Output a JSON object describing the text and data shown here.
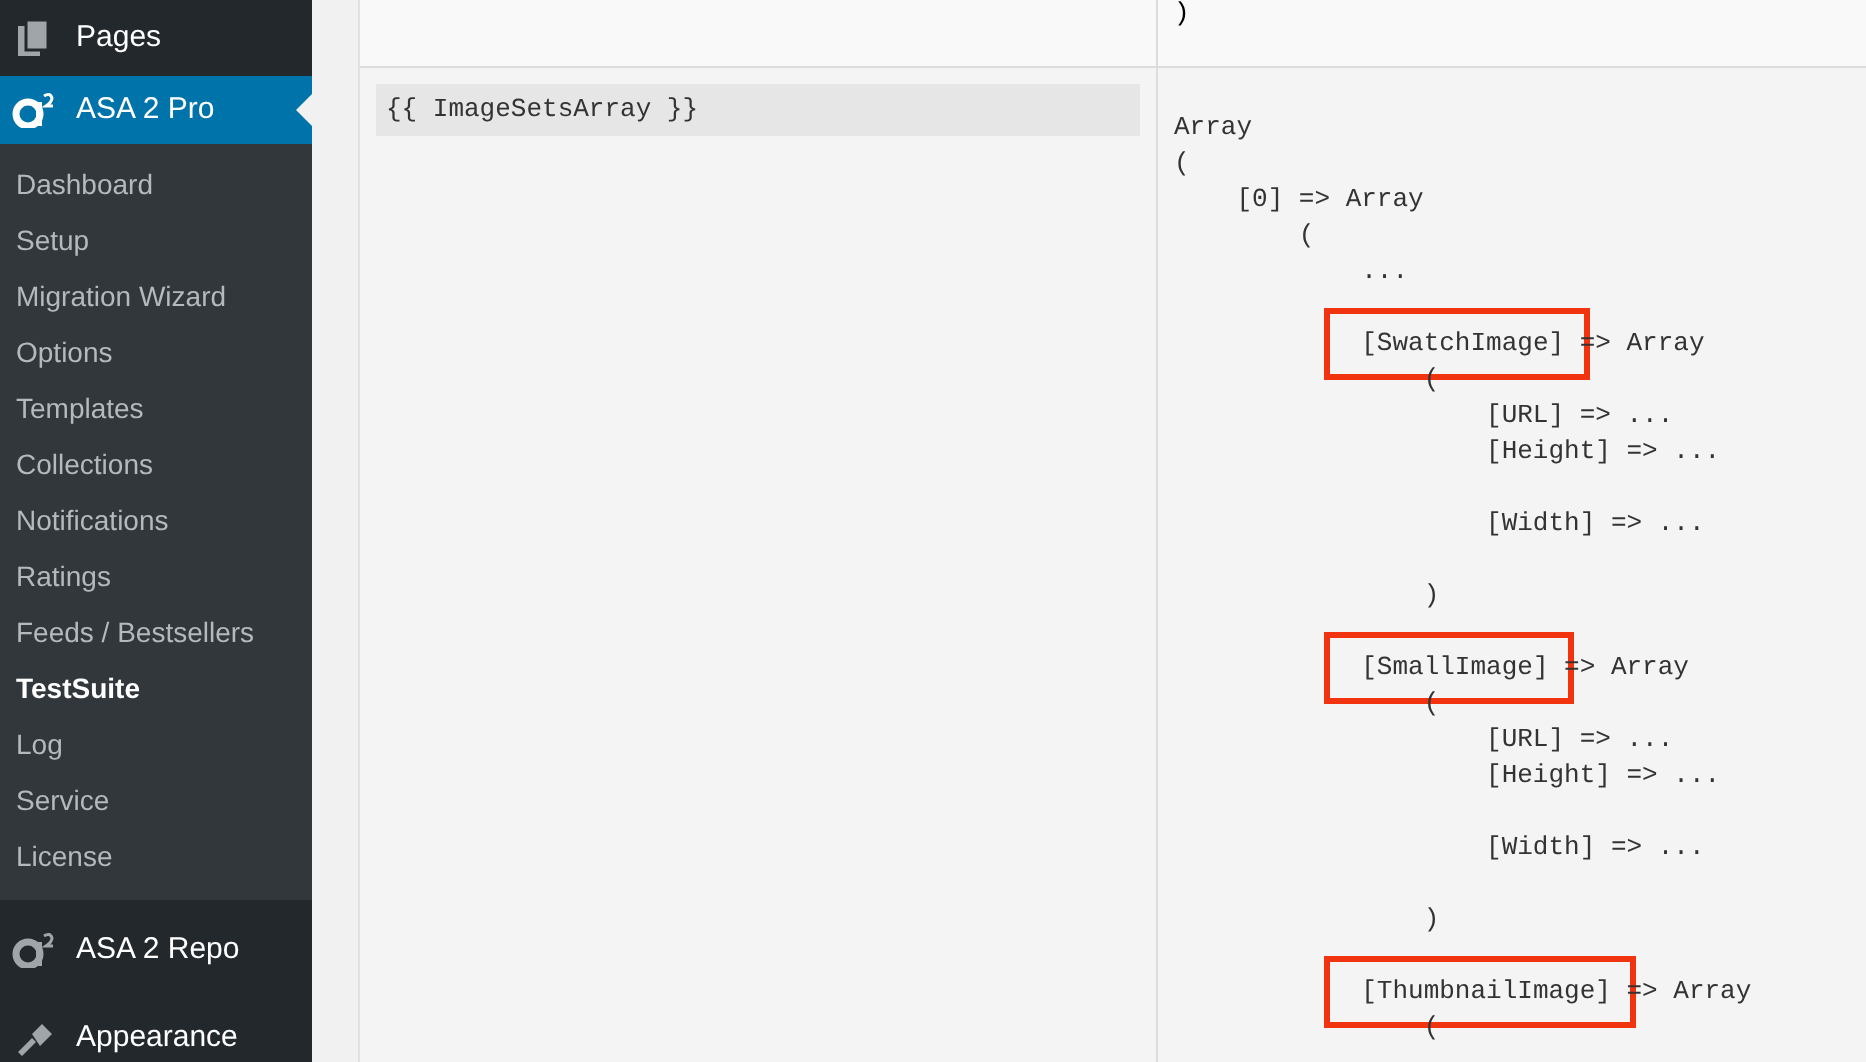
{
  "sidebar": {
    "menu_top": [
      {
        "label": "Pages",
        "kind": "pages",
        "selected": false
      },
      {
        "label": "ASA 2 Pro",
        "kind": "asa",
        "selected": true
      }
    ],
    "submenu": [
      {
        "label": "Dashboard",
        "selected": false
      },
      {
        "label": "Setup",
        "selected": false
      },
      {
        "label": "Migration Wizard",
        "selected": false
      },
      {
        "label": "Options",
        "selected": false
      },
      {
        "label": "Templates",
        "selected": false
      },
      {
        "label": "Collections",
        "selected": false
      },
      {
        "label": "Notifications",
        "selected": false
      },
      {
        "label": "Ratings",
        "selected": false
      },
      {
        "label": "Feeds / Bestsellers",
        "selected": false
      },
      {
        "label": "TestSuite",
        "selected": true
      },
      {
        "label": "Log",
        "selected": false
      },
      {
        "label": "Service",
        "selected": false
      },
      {
        "label": "License",
        "selected": false
      }
    ],
    "menu_bottom": [
      {
        "label": "ASA 2 Repo",
        "kind": "asa",
        "selected": false
      },
      {
        "label": "Appearance",
        "kind": "brush",
        "selected": false
      }
    ]
  },
  "table": {
    "top_row": {
      "output_tail": ")"
    },
    "row": {
      "placeholder_code": "{{ ImageSetsArray }}",
      "output": [
        {
          "text": "Array"
        },
        {
          "text": "("
        },
        {
          "text": "    [0] => Array"
        },
        {
          "text": "        ("
        },
        {
          "text": "            ..."
        },
        {
          "text": "            [SwatchImage]",
          "after": " => Array",
          "highlighted": true,
          "space_before": true
        },
        {
          "text": "                ("
        },
        {
          "text": "                    [URL] => ..."
        },
        {
          "text": "                    [Height] => ..."
        },
        {
          "text": "                    [Width] => ...",
          "space_before": true
        },
        {
          "text": "                )",
          "space_before": true
        },
        {
          "text": "            [SmallImage]",
          "after": " => Array",
          "highlighted": true,
          "space_before": true
        },
        {
          "text": "                ("
        },
        {
          "text": "                    [URL] => ..."
        },
        {
          "text": "                    [Height] => ..."
        },
        {
          "text": "                    [Width] => ...",
          "space_before": true
        },
        {
          "text": "                )",
          "space_before": true
        },
        {
          "text": "            [ThumbnailImage]",
          "after": " => Array",
          "highlighted": true,
          "space_before": true
        },
        {
          "text": "                ("
        }
      ]
    }
  }
}
